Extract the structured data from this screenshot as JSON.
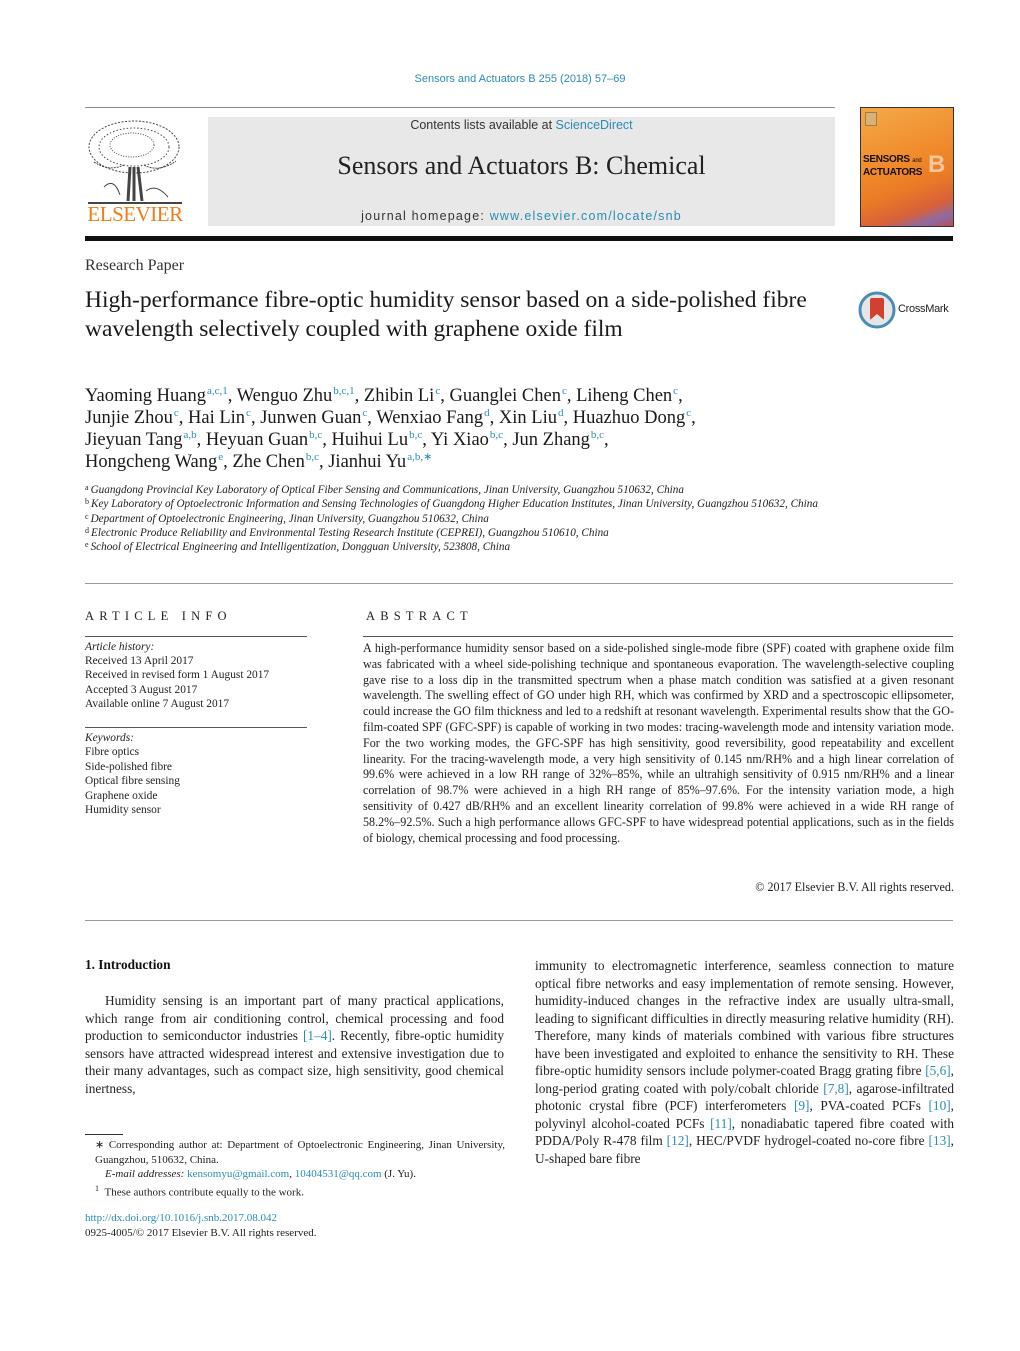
{
  "header": {
    "journal_ref": "Sensors and Actuators B 255 (2018) 57–69",
    "contents_prefix": "Contents lists available at ",
    "contents_link": "ScienceDirect",
    "journal_title": "Sensors and Actuators B: Chemical",
    "homepage_prefix": "journal homepage: ",
    "homepage_link": "www.elsevier.com/locate/snb",
    "publisher_logo_text": "ELSEVIER",
    "cover_title_line1": "SENSORS",
    "cover_title_and": "and",
    "cover_title_line2": "ACTUATORS",
    "cover_letter": "B"
  },
  "article": {
    "type": "Research Paper",
    "title": "High-performance fibre-optic humidity sensor based on a side-polished fibre wavelength selectively coupled with graphene oxide film",
    "crossmark_label": "CrossMark",
    "authors": [
      {
        "name": "Yaoming Huang",
        "aff": "a,c,1"
      },
      {
        "name": "Wenguo Zhu",
        "aff": "b,c,1"
      },
      {
        "name": "Zhibin Li",
        "aff": "c"
      },
      {
        "name": "Guanglei Chen",
        "aff": "c"
      },
      {
        "name": "Liheng Chen",
        "aff": "c"
      },
      {
        "name": "Junjie Zhou",
        "aff": "c"
      },
      {
        "name": "Hai Lin",
        "aff": "c"
      },
      {
        "name": "Junwen Guan",
        "aff": "c"
      },
      {
        "name": "Wenxiao Fang",
        "aff": "d"
      },
      {
        "name": "Xin Liu",
        "aff": "d"
      },
      {
        "name": "Huazhuo Dong",
        "aff": "c"
      },
      {
        "name": "Jieyuan Tang",
        "aff": "a,b"
      },
      {
        "name": "Heyuan Guan",
        "aff": "b,c"
      },
      {
        "name": "Huihui Lu",
        "aff": "b,c"
      },
      {
        "name": "Yi Xiao",
        "aff": "b,c"
      },
      {
        "name": "Jun Zhang",
        "aff": "b,c"
      },
      {
        "name": "Hongcheng Wang",
        "aff": "e"
      },
      {
        "name": "Zhe Chen",
        "aff": "b,c"
      },
      {
        "name": "Jianhui Yu",
        "aff": "a,b,∗"
      }
    ],
    "affiliations": [
      {
        "key": "a",
        "text": "Guangdong Provincial Key Laboratory of Optical Fiber Sensing and Communications, Jinan University, Guangzhou 510632, China"
      },
      {
        "key": "b",
        "text": "Key Laboratory of Optoelectronic Information and Sensing Technologies of Guangdong Higher Education Institutes, Jinan University, Guangzhou 510632, China"
      },
      {
        "key": "c",
        "text": "Department of Optoelectronic Engineering, Jinan University, Guangzhou 510632, China"
      },
      {
        "key": "d",
        "text": "Electronic Produce Reliability and Environmental Testing Research Institute (CEPREI), Guangzhou 510610, China"
      },
      {
        "key": "e",
        "text": "School of Electrical Engineering and Intelligentization, Dongguan University, 523808, China"
      }
    ]
  },
  "article_info": {
    "heading": "ARTICLE INFO",
    "history_label": "Article history:",
    "history": [
      "Received 13 April 2017",
      "Received in revised form 1 August 2017",
      "Accepted 3 August 2017",
      "Available online 7 August 2017"
    ],
    "keywords_label": "Keywords:",
    "keywords": [
      "Fibre optics",
      "Side-polished fibre",
      "Optical fibre sensing",
      "Graphene oxide",
      "Humidity sensor"
    ]
  },
  "abstract": {
    "heading": "ABSTRACT",
    "text": "A high-performance humidity sensor based on a side-polished single-mode fibre (SPF) coated with graphene oxide film was fabricated with a wheel side-polishing technique and spontaneous evaporation. The wavelength-selective coupling gave rise to a loss dip in the transmitted spectrum when a phase match condition was satisfied at a given resonant wavelength. The swelling effect of GO under high RH, which was confirmed by XRD and a spectroscopic ellipsometer, could increase the GO film thickness and led to a redshift at resonant wavelength. Experimental results show that the GO-film-coated SPF (GFC-SPF) is capable of working in two modes: tracing-wavelength mode and intensity variation mode. For the two working modes, the GFC-SPF has high sensitivity, good reversibility, good repeatability and excellent linearity. For the tracing-wavelength mode, a very high sensitivity of 0.145 nm/RH% and a high linear correlation of 99.6% were achieved in a low RH range of 32%–85%, while an ultrahigh sensitivity of 0.915 nm/RH% and a linear correlation of 98.7% were achieved in a high RH range of 85%–97.6%. For the intensity variation mode, a high sensitivity of 0.427 dB/RH% and an excellent linearity correlation of 99.8% were achieved in a wide RH range of 58.2%–92.5%. Such a high performance allows GFC-SPF to have widespread potential applications, such as in the fields of biology, chemical processing and food processing.",
    "copyright": "© 2017 Elsevier B.V. All rights reserved."
  },
  "body": {
    "section_heading": "1.  Introduction",
    "col1": [
      {
        "t": "Humidity sensing is an important part of many practical applications, which range from air conditioning control, chemical processing and food production to semiconductor industries "
      },
      {
        "ref": "[1–4]"
      },
      {
        "t": ". Recently, fibre-optic humidity sensors have attracted widespread interest and extensive investigation due to their many advantages, such as compact size, high sensitivity, good chemical inertness,"
      }
    ],
    "col2": [
      {
        "t": "immunity to electromagnetic interference, seamless connection to mature optical fibre networks and easy implementation of remote sensing. However, humidity-induced changes in the refractive index are usually ultra-small, leading to significant difficulties in directly measuring relative humidity (RH). Therefore, many kinds of materials combined with various fibre structures have been investigated and exploited to enhance the sensitivity to RH. These fibre-optic humidity sensors include polymer-coated Bragg grating fibre "
      },
      {
        "ref": "[5,6]"
      },
      {
        "t": ", long-period grating coated with poly/cobalt chloride "
      },
      {
        "ref": "[7,8]"
      },
      {
        "t": ", agarose-infiltrated photonic crystal fibre (PCF) interferometers "
      },
      {
        "ref": "[9]"
      },
      {
        "t": ", PVA-coated PCFs "
      },
      {
        "ref": "[10]"
      },
      {
        "t": ", polyvinyl alcohol-coated PCFs "
      },
      {
        "ref": "[11]"
      },
      {
        "t": ", nonadiabatic tapered fibre coated with PDDA/Poly R-478 film "
      },
      {
        "ref": "[12]"
      },
      {
        "t": ", HEC/PVDF hydrogel-coated no-core fibre "
      },
      {
        "ref": "[13]"
      },
      {
        "t": ", U-shaped bare fibre"
      }
    ]
  },
  "footnotes": {
    "corresponding": "∗ Corresponding author at: Department of Optoelectronic Engineering, Jinan University, Guangzhou, 510632, China.",
    "email_label": "E-mail addresses: ",
    "email1": "kensomyu@gmail.com",
    "email_sep": ", ",
    "email2": "10404531@qq.com",
    "email_suffix": " (J. Yu).",
    "equal_marker": "1",
    "equal_text": "These authors contribute equally to the work.",
    "doi": "http://dx.doi.org/10.1016/j.snb.2017.08.042",
    "issn": "0925-4005/© 2017 Elsevier B.V. All rights reserved."
  },
  "colors": {
    "link": "#2a8bb5",
    "elsevier_orange": "#f07d16",
    "header_box": "#e8e8e8"
  }
}
